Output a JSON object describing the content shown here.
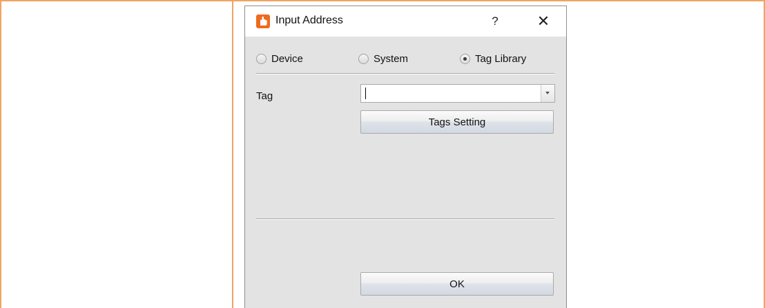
{
  "dialog": {
    "title": "Input Address",
    "help_label": "?",
    "close_label": "✕",
    "icon": "app-hand-icon"
  },
  "source_options": [
    {
      "label": "Device",
      "checked": false
    },
    {
      "label": "System",
      "checked": false
    },
    {
      "label": "Tag Library",
      "checked": true
    }
  ],
  "tag": {
    "label": "Tag",
    "value": ""
  },
  "buttons": {
    "tags_setting": "Tags Setting",
    "ok": "OK"
  },
  "colors": {
    "table_border": "#f0a460",
    "dialog_background": "#e3e3e3",
    "app_icon": "#ef6a20"
  }
}
